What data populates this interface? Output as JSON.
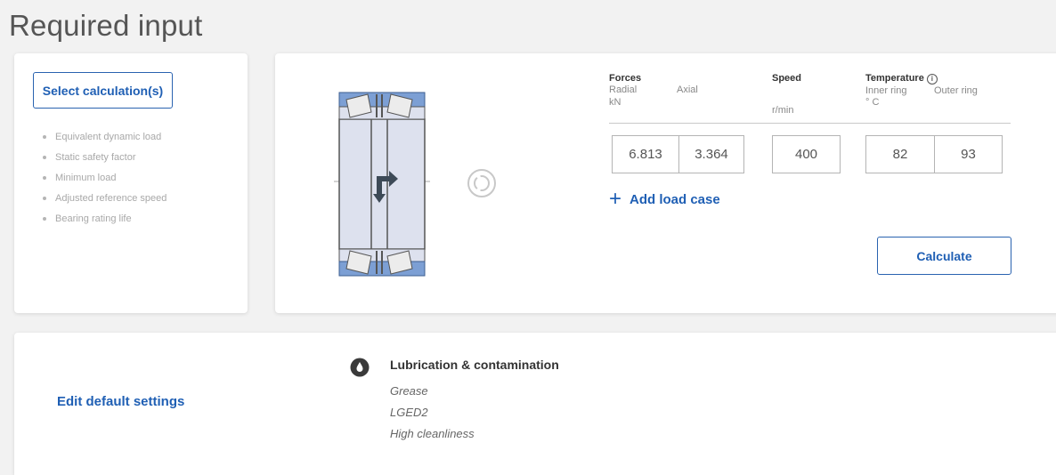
{
  "page": {
    "title": "Required input"
  },
  "calculations": {
    "select_button": "Select calculation(s)",
    "items": [
      "Equivalent dynamic load",
      "Static safety factor",
      "Minimum load",
      "Adjusted reference speed",
      "Bearing rating life"
    ]
  },
  "inputs": {
    "forces": {
      "label": "Forces",
      "radial_label": "Radial",
      "axial_label": "Axial",
      "unit": "kN"
    },
    "speed": {
      "label": "Speed",
      "unit": "r/min"
    },
    "temperature": {
      "label": "Temperature",
      "info_glyph": "i",
      "inner_label": "Inner ring",
      "outer_label": "Outer ring",
      "unit": "° C"
    },
    "load_case": {
      "radial": "6.813",
      "axial": "3.364",
      "speed": "400",
      "inner_ring": "82",
      "outer_ring": "93"
    },
    "add_load_case": "Add load case",
    "add_icon": "+",
    "calculate_button": "Calculate"
  },
  "settings": {
    "edit_link": "Edit default settings",
    "lubrication": {
      "title": "Lubrication & contamination",
      "icon": "drop-icon",
      "lines": [
        "Grease",
        "LGED2",
        "High cleanliness"
      ]
    }
  },
  "colors": {
    "accent": "#1f5fb4",
    "bearing_blue": "#7c9fd4",
    "bearing_fill": "#dde1ee",
    "arrow": "#3d4a57"
  }
}
